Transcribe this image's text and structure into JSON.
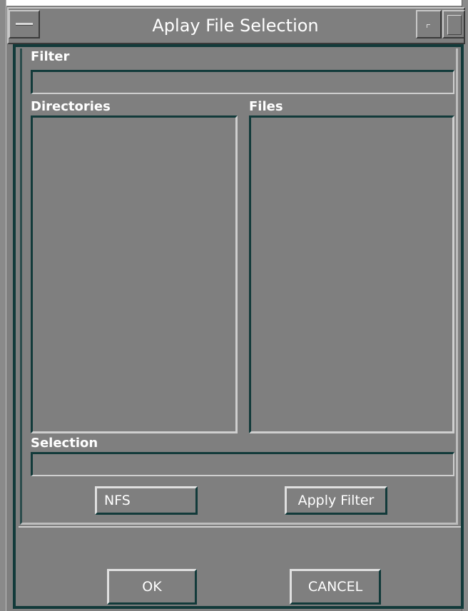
{
  "window": {
    "title": "Aplay File Selection"
  },
  "labels": {
    "filter": "Filter",
    "directories": "Directories",
    "files": "Files",
    "selection": "Selection"
  },
  "inputs": {
    "filter_value": "",
    "selection_value": ""
  },
  "lists": {
    "directories": [],
    "files": []
  },
  "buttons": {
    "nfs": "NFS",
    "apply_filter": "Apply Filter",
    "ok": "OK",
    "cancel": "CANCEL"
  },
  "colors": {
    "background": "#7f7f7f",
    "border_dark": "#123a3a",
    "text": "#ffffff"
  }
}
